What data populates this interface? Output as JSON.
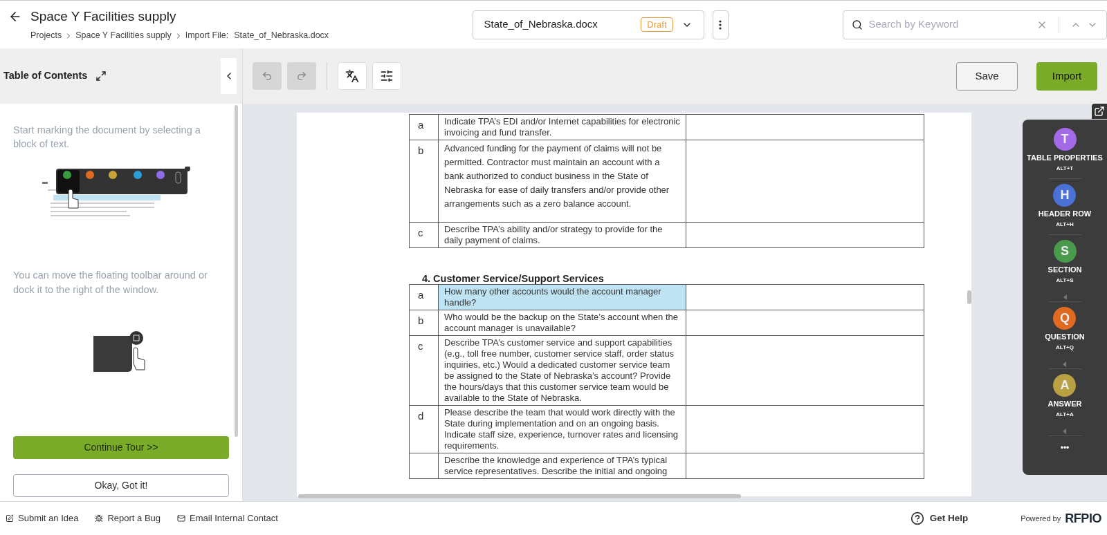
{
  "header": {
    "title": "Space Y Facilities supply",
    "breadcrumbs": [
      "Projects",
      "Space Y Facilities supply",
      "Import File:"
    ],
    "breadcrumb_file": "State_of_Nebraska.docx"
  },
  "file_select": {
    "value": "State_of_Nebraska.docx",
    "badge": "Draft"
  },
  "search": {
    "placeholder": "Search by Keyword"
  },
  "sidebar": {
    "title": "Table of Contents",
    "tips": [
      "Start marking the document by selecting a block of text.",
      "You can move the floating toolbar around or dock it to the right of the window."
    ],
    "buttons": [
      "Continue Tour >>",
      "Okay, Got it!"
    ]
  },
  "toolbar": {
    "undo_disabled": true,
    "redo_disabled": true,
    "buttons": [
      "Save",
      "Import"
    ]
  },
  "document": {
    "table_1": [
      {
        "label": "a",
        "text": "Indicate TPA’s EDI and/or Internet capabilities for electronic invoicing and fund transfer.",
        "selected": false
      },
      {
        "label": "b",
        "text": "Advanced funding for the payment of claims will not be permitted. Contractor must maintain an account with a bank authorized to conduct business in the State of Nebraska for ease of daily transfers and/or provide other arrangements such as a zero balance account.",
        "selected": false
      },
      {
        "label": "c",
        "text": "Describe TPA’s ability and/or strategy to provide for the daily payment of claims.",
        "selected": false
      }
    ],
    "section_heading": "4.  Customer Service/Support Services",
    "table_2": [
      {
        "label": "a",
        "text": "How many other accounts would the account manager handle?",
        "selected": true
      },
      {
        "label": "b",
        "text": "Who would be the backup on the State’s account when the account manager is unavailable?",
        "selected": false
      },
      {
        "label": "c",
        "text": "Describe TPA’s customer service and support capabilities (e.g., toll free number, customer service staff, order status inquiries, etc.) Would a dedicated customer service team be assigned to the State of Nebraska’s account? Provide the hours/days that this customer service team would be available to the State of Nebraska.",
        "selected": false
      },
      {
        "label": "d",
        "text": "Please describe the team that would work directly with the State during implementation and on an ongoing basis. Indicate staff size, experience, turnover rates and licensing requirements.",
        "selected": false
      },
      {
        "text": "Describe the knowledge and experience of TPA’s typical service representatives. Describe the initial and ongoing",
        "selected": false
      }
    ]
  },
  "dock": {
    "items": [
      {
        "letter": "T",
        "label": "TABLE PROPERTIES",
        "shortcut": "ALT+T",
        "color": "#a46be8",
        "caret": false
      },
      {
        "letter": "H",
        "label": "HEADER ROW",
        "shortcut": "ALT+H",
        "color": "#4a72d6",
        "caret": false
      },
      {
        "letter": "S",
        "label": "SECTION",
        "shortcut": "ALT+S",
        "color": "#4a9a4e",
        "caret": true
      },
      {
        "letter": "Q",
        "label": "QUESTION",
        "shortcut": "ALT+Q",
        "color": "#e06a22",
        "caret": true
      },
      {
        "letter": "A",
        "label": "ANSWER",
        "shortcut": "ALT+A",
        "color": "#b9a043",
        "caret": true
      }
    ],
    "more": "•••"
  },
  "footer": {
    "links": [
      {
        "kind": "idea",
        "label": "Submit an Idea"
      },
      {
        "kind": "bug",
        "label": "Report a Bug"
      },
      {
        "kind": "mail",
        "label": "Email Internal Contact"
      }
    ],
    "help": "Get Help",
    "powered_by": "Powered by",
    "brand": "RFPIO"
  }
}
